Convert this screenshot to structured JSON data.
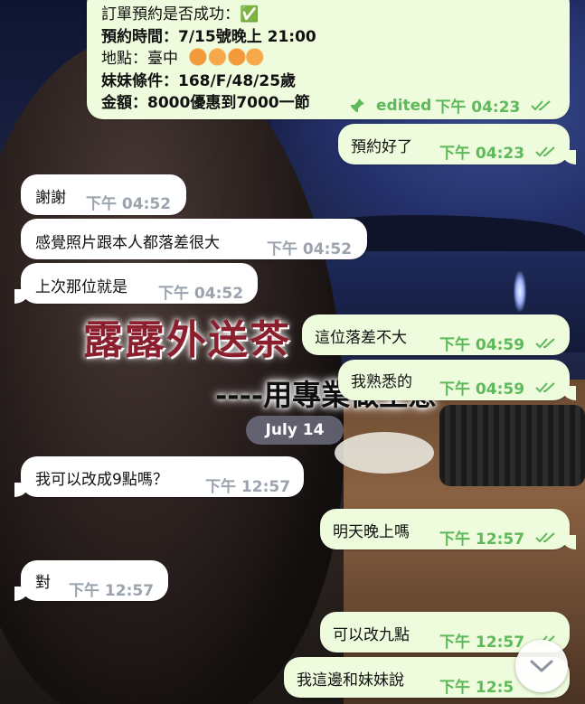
{
  "background": {
    "brand_text": "露露外送茶",
    "brand_subtext": "----用專業做生意"
  },
  "colors": {
    "incoming_bubble": "#ffffff",
    "outgoing_bubble": "#eefbdc",
    "outgoing_meta": "#5db95a",
    "incoming_meta": "#9ba3ad"
  },
  "booking": {
    "line1": "訂單預約是否成功：✅",
    "line2": "預約時間：7/15號晚上 21:00",
    "line3": "地點：臺中",
    "line4": "妹妹條件：168/F/48/25歲",
    "line5": "金額：8000優惠到7000一節",
    "edited_label": "edited",
    "time": "下午 04:23",
    "pin_icon": "pin-icon",
    "read_icon": "double-check-icon"
  },
  "messages": [
    {
      "text": "預約好了",
      "time": "下午 04:23",
      "direction": "out"
    },
    {
      "text": "謝謝",
      "time": "下午 04:52",
      "direction": "in"
    },
    {
      "text": "感覺照片跟本人都落差很大",
      "time": "下午 04:52",
      "direction": "in"
    },
    {
      "text": "上次那位就是",
      "time": "下午 04:52",
      "direction": "in"
    },
    {
      "text": "這位落差不大",
      "time": "下午 04:59",
      "direction": "out"
    },
    {
      "text": "我熟悉的",
      "time": "下午 04:59",
      "direction": "out"
    },
    {
      "text": "我可以改成9點嗎？",
      "time": "下午 12:57",
      "direction": "in"
    },
    {
      "text": "明天晚上嗎",
      "time": "下午 12:57",
      "direction": "out"
    },
    {
      "text": "對",
      "time": "下午 12:57",
      "direction": "in"
    },
    {
      "text": "可以改九點",
      "time": "下午 12:57",
      "direction": "out"
    },
    {
      "text": "我這邊和妹妹說",
      "time": "下午 12:5",
      "direction": "out"
    }
  ],
  "date_separator": "July 14",
  "scroll_button_icon": "chevron-down-icon"
}
